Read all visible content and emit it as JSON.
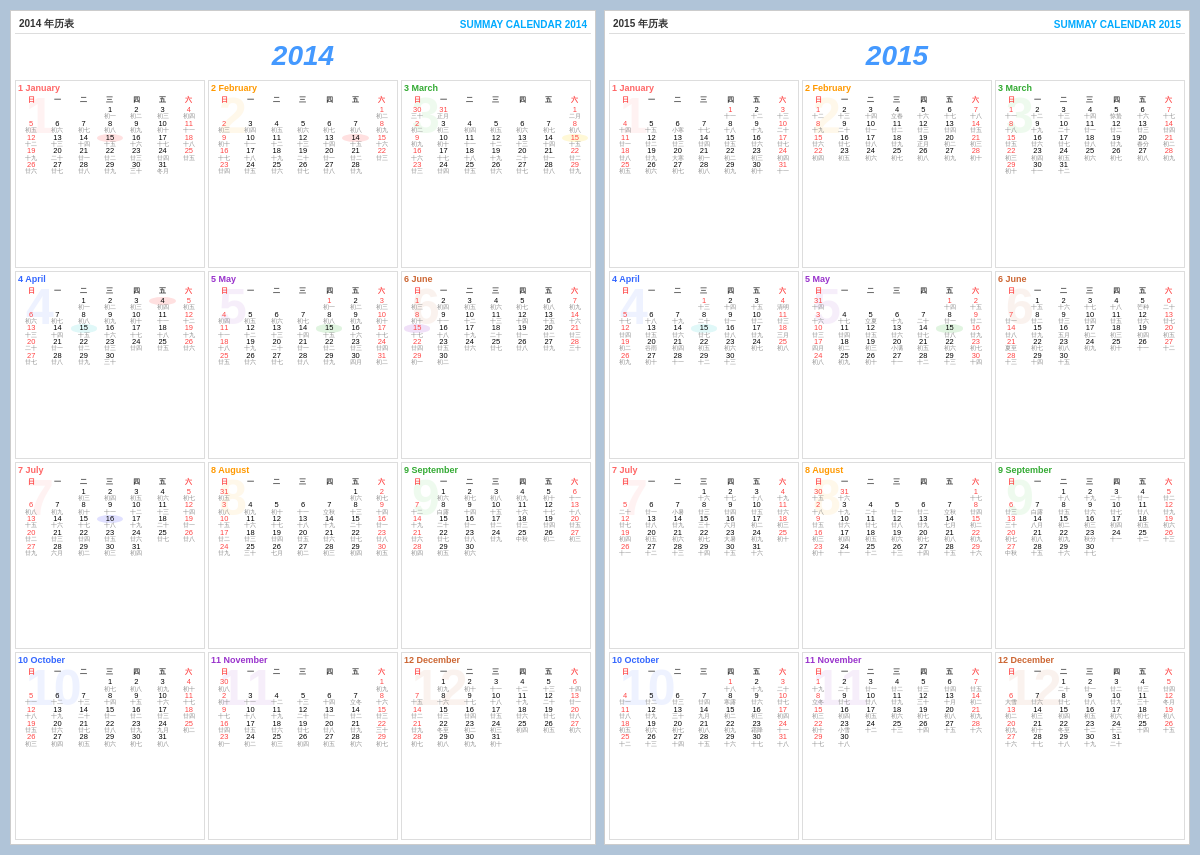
{
  "left_panel": {
    "header_left": "2014  年历表",
    "header_right": "SUMMAY CALENDAR 2014",
    "year": "2014"
  },
  "right_panel": {
    "header_left": "2015  年历表",
    "header_right": "SUMMAY CALENDAR 2015",
    "year": "2015"
  },
  "weekdays": [
    "日",
    "一",
    "二",
    "三",
    "四",
    "五",
    "六"
  ]
}
